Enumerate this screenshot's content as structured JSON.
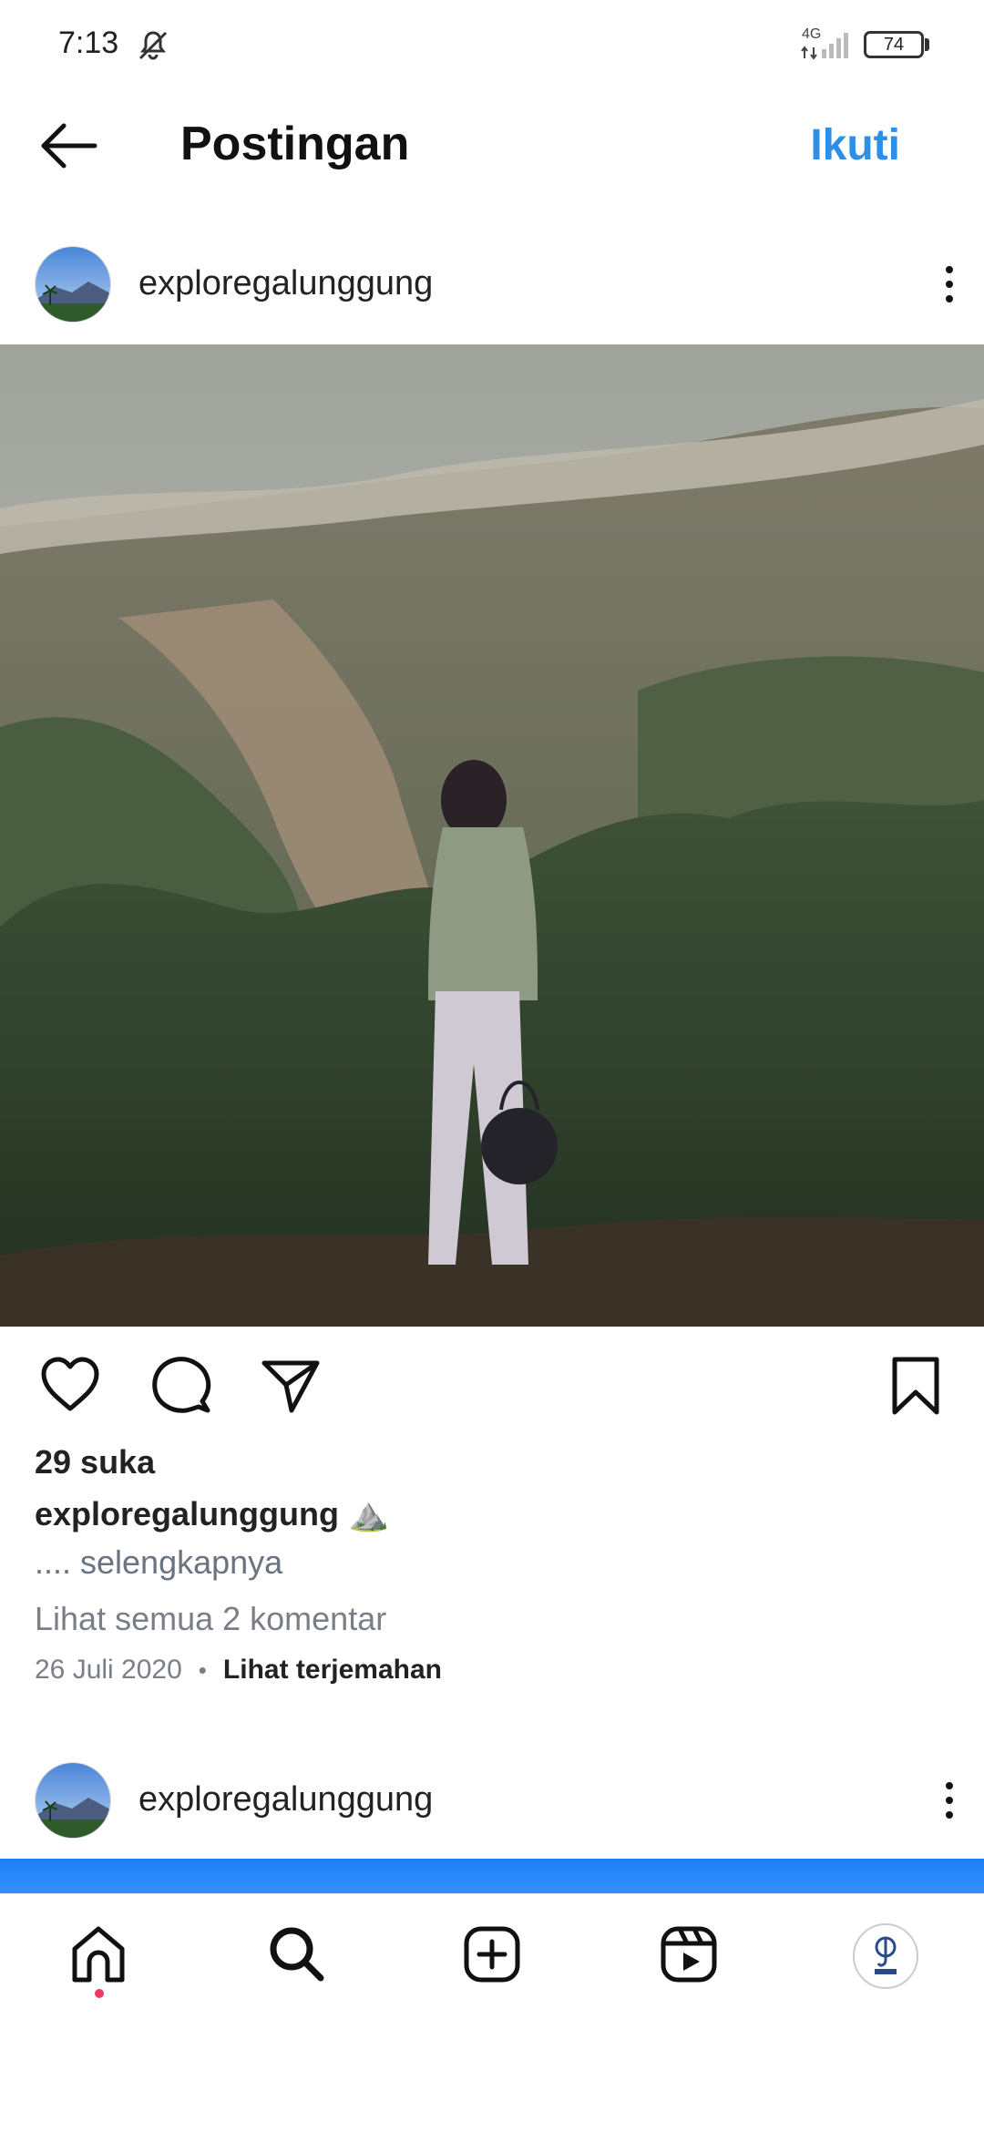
{
  "status_bar": {
    "time": "7:13",
    "network": "4G",
    "battery": "74"
  },
  "nav": {
    "title": "Postingan",
    "follow": "Ikuti"
  },
  "post": {
    "username": "exploregalunggung",
    "likes": "29 suka",
    "caption_user": "exploregalunggung",
    "caption_emoji": "⛰️",
    "caption_more": ".... selengkapnya",
    "view_comments": "Lihat semua 2 komentar",
    "date": "26 Juli 2020",
    "separator": "•",
    "translate": "Lihat terjemahan"
  },
  "next_post": {
    "username": "exploregalunggung"
  },
  "colors": {
    "accent": "#2f8fe6",
    "notification_dot": "#ef3a5d",
    "muted_text": "#7a7f87"
  },
  "icons": {
    "back": "arrow-left-icon",
    "more": "more-vertical-icon",
    "like": "heart-icon",
    "comment": "comment-icon",
    "share": "send-icon",
    "save": "bookmark-icon",
    "home": "home-icon",
    "search": "search-icon",
    "create": "plus-square-icon",
    "reels": "reels-icon",
    "profile": "profile-avatar-icon"
  }
}
